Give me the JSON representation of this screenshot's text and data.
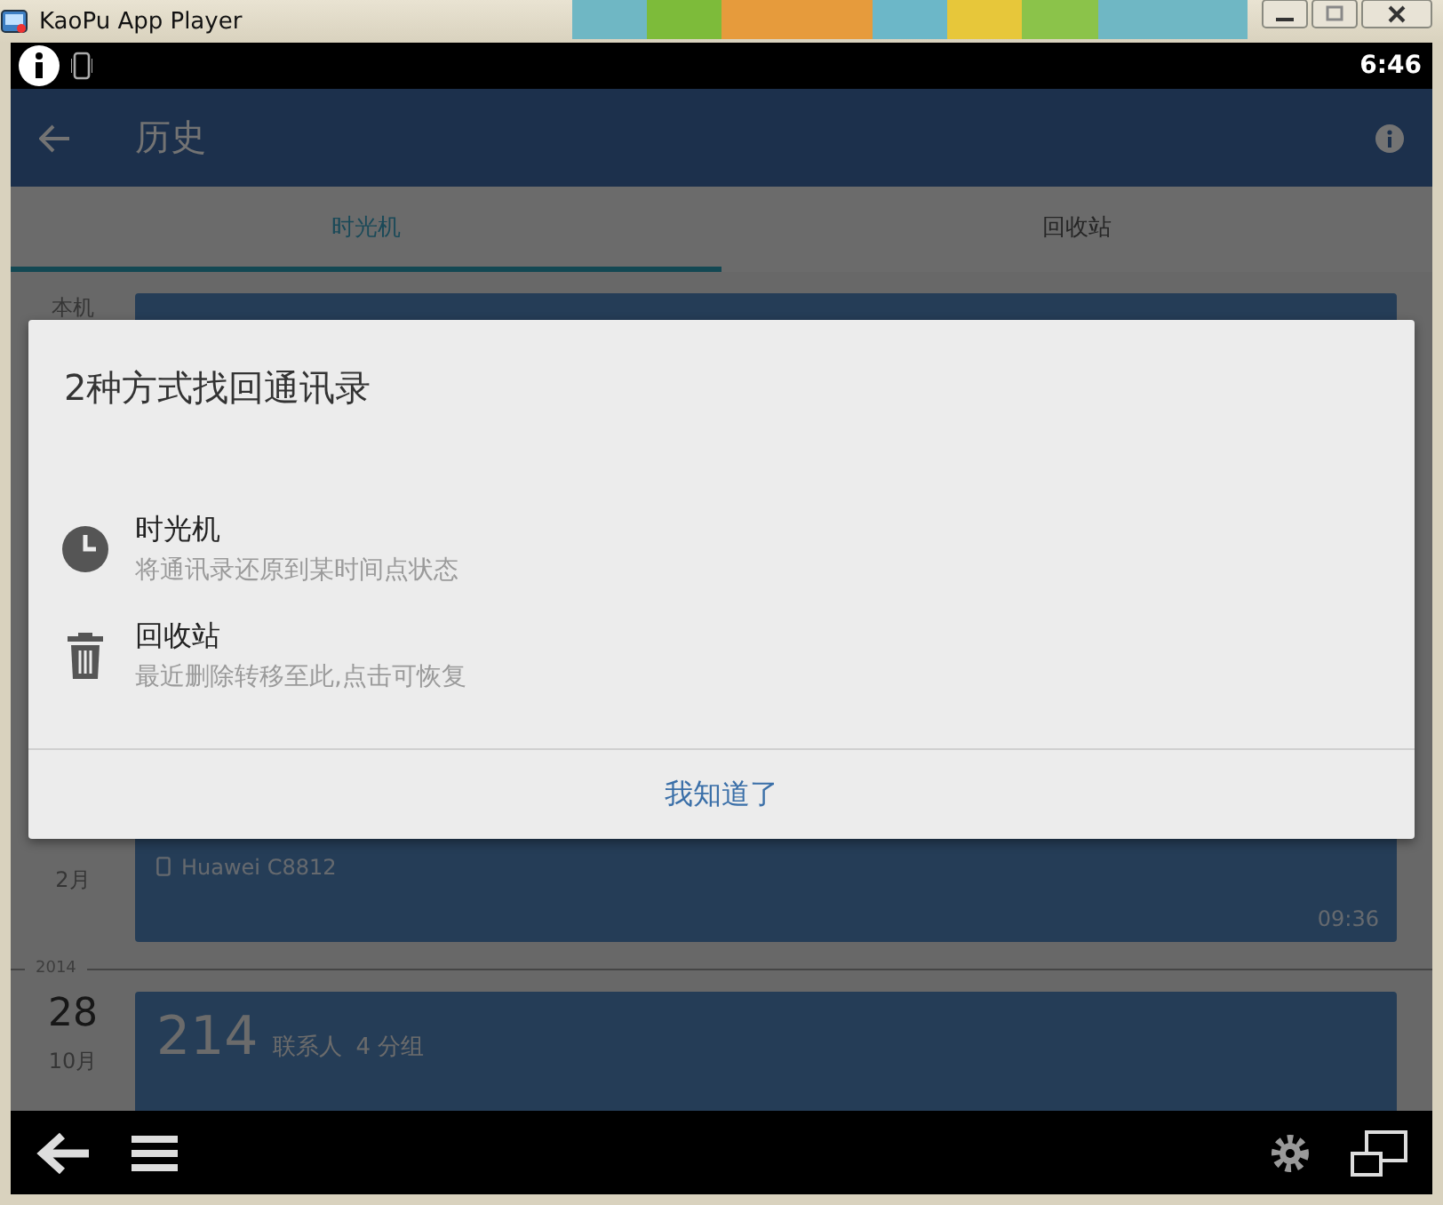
{
  "window": {
    "title": "KaoPu App Player"
  },
  "status_bar": {
    "time": "6:46"
  },
  "app_bar": {
    "title": "历史"
  },
  "tabs": [
    {
      "label": "时光机",
      "selected": true
    },
    {
      "label": "回收站",
      "selected": false
    }
  ],
  "timeline": [
    {
      "kind": "entry",
      "side": "本机"
    },
    {
      "kind": "entry",
      "month": "2月",
      "device": "Huawei C8812",
      "time": "09:36"
    },
    {
      "kind": "year",
      "label": "2014"
    },
    {
      "kind": "entry",
      "day": "28",
      "month": "10月",
      "count": "214",
      "count_label": "联系人",
      "groups": "4 分组"
    }
  ],
  "dialog": {
    "title": "2种方式找回通讯录",
    "options": [
      {
        "kind": "clock",
        "title": "时光机",
        "subtitle": "将通讯录还原到某时间点状态"
      },
      {
        "kind": "trash",
        "title": "回收站",
        "subtitle": "最近删除转移至此,点击可恢复"
      }
    ],
    "button": "我知道了"
  }
}
